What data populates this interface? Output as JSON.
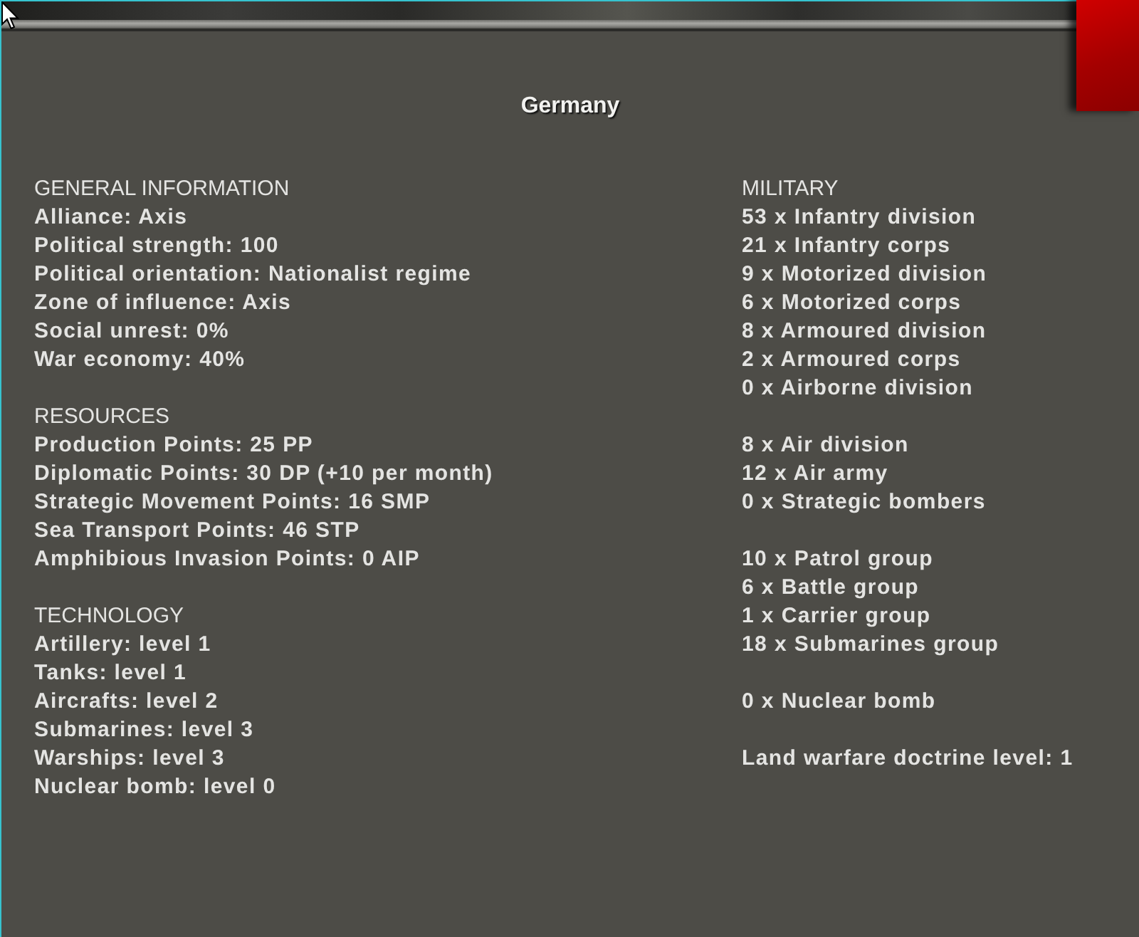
{
  "window": {
    "title": "Germany"
  },
  "left_sections": [
    {
      "heading": "GENERAL INFORMATION",
      "lines": [
        "Alliance: Axis",
        "Political strength: 100",
        "Political orientation: Nationalist regime",
        "Zone of influence: Axis",
        "Social unrest: 0%",
        "War economy: 40%"
      ]
    },
    {
      "heading": "RESOURCES",
      "lines": [
        "Production Points: 25 PP",
        "Diplomatic Points: 30 DP (+10 per month)",
        "Strategic Movement Points: 16 SMP",
        "Sea Transport Points: 46 STP",
        "Amphibious Invasion Points: 0 AIP"
      ]
    },
    {
      "heading": "TECHNOLOGY",
      "lines": [
        "Artillery: level 1",
        "Tanks: level 1",
        "Aircrafts: level 2",
        "Submarines: level 3",
        "Warships: level 3",
        "Nuclear bomb: level 0"
      ]
    }
  ],
  "military": {
    "heading": "MILITARY",
    "groups": [
      {
        "lines": [
          "53 x Infantry division",
          "21 x Infantry corps",
          "9 x Motorized division",
          "6 x Motorized corps",
          "8 x Armoured division",
          "2 x Armoured corps",
          "0 x Airborne division"
        ]
      },
      {
        "lines": [
          "8 x Air division",
          "12 x Air army",
          "0 x Strategic bombers"
        ]
      },
      {
        "lines": [
          "10 x Patrol group",
          "6 x Battle group",
          "1 x Carrier group",
          "18 x Submarines group"
        ]
      },
      {
        "lines": [
          "0 x Nuclear bomb"
        ]
      },
      {
        "lines": [
          "Land warfare doctrine level: 1"
        ]
      }
    ]
  }
}
